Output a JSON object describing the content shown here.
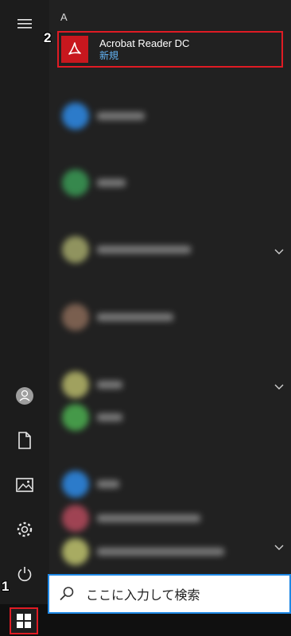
{
  "start_menu": {
    "section_letter": "A",
    "featured_app": {
      "name": "Acrobat Reader DC",
      "badge": "新規",
      "icon": "acrobat-icon",
      "tile_color": "#c8171e",
      "highlight_color": "#e01b24"
    }
  },
  "sidebar": {
    "icons": [
      "hamburger-icon",
      "user-icon",
      "documents-icon",
      "pictures-icon",
      "settings-icon",
      "power-icon"
    ]
  },
  "taskbar": {
    "search_placeholder": "ここに入力して検索",
    "search_icon": "search-icon",
    "start_icon": "windows-icon"
  },
  "annotations": {
    "step1": "1",
    "step2": "2"
  },
  "colors": {
    "accent": "#1e88e5",
    "highlight_border": "#e01b24",
    "badge_text": "#64b5f6"
  }
}
